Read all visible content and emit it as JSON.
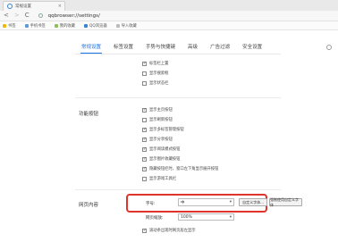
{
  "tab": {
    "title": "常规设置",
    "close": "×"
  },
  "addressbar": {
    "back": "<",
    "forward": ">",
    "refresh": "C",
    "url": "qqbrowser://settings/"
  },
  "bookmarks": [
    {
      "label": "书签",
      "color": "#f2b705"
    },
    {
      "label": "手机书签",
      "color": "#5a9bd8"
    },
    {
      "label": "我的收藏",
      "color": "#8fbf5a"
    },
    {
      "label": "QQ浏览器",
      "color": "#3a84d6"
    },
    {
      "label": "导入收藏",
      "color": "#bbbbbb"
    }
  ],
  "settings_nav": [
    {
      "label": "常规设置",
      "active": true
    },
    {
      "label": "标签设置",
      "active": false
    },
    {
      "label": "手势与快捷键",
      "active": false
    },
    {
      "label": "高级",
      "active": false
    },
    {
      "label": "广告过滤",
      "active": false
    },
    {
      "label": "安全设置",
      "active": false
    }
  ],
  "top_checkboxes": [
    {
      "label": "标签栏上置",
      "checked": true
    },
    {
      "label": "显示搜索框",
      "checked": false
    },
    {
      "label": "显示状态栏",
      "checked": false
    }
  ],
  "func_section": {
    "label": "功能按钮"
  },
  "func_checkboxes": [
    {
      "label": "显示主页按钮",
      "checked": true
    },
    {
      "label": "显示刷新按钮",
      "checked": false
    },
    {
      "label": "显示多标签管理按钮",
      "checked": true
    },
    {
      "label": "显示分享按钮",
      "checked": true
    },
    {
      "label": "显示阅读模式按钮",
      "checked": true
    },
    {
      "label": "显示图片收藏按钮",
      "checked": true
    },
    {
      "label": "隐藏按钮栏时，窗口左下角显示展开按钮",
      "checked": true
    },
    {
      "label": "显示游戏工具栏",
      "checked": false
    }
  ],
  "web_content": {
    "label": "网页内容",
    "font_size_label": "字号:",
    "font_size_value": "中",
    "custom_font_button": "自定义字体...",
    "force_font_button": "强制使用自定义字体",
    "zoom_label": "网页缩放:",
    "zoom_value": "100%",
    "bottom_checkbox": {
      "label": "滚动条出现时网页居左显示",
      "checked": true
    }
  },
  "colors": {
    "accent": "#1a73e8",
    "highlight": "#e0332b"
  }
}
